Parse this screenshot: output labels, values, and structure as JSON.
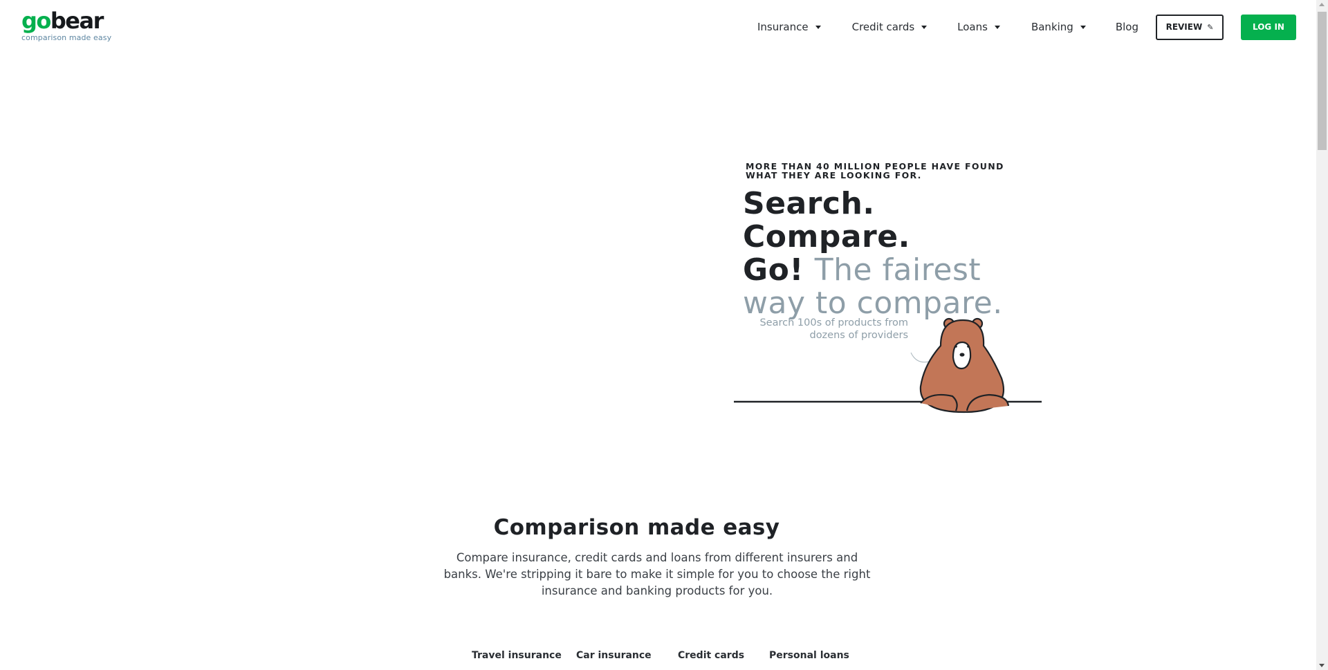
{
  "brand": {
    "logo_go": "go",
    "logo_bear": "bear",
    "tagline": "comparison made easy",
    "primary_color": "#05b04e",
    "bear_color": "#c27657"
  },
  "nav": {
    "items": [
      {
        "label": "Insurance",
        "has_dropdown": true
      },
      {
        "label": "Credit cards",
        "has_dropdown": true
      },
      {
        "label": "Loans",
        "has_dropdown": true
      },
      {
        "label": "Banking",
        "has_dropdown": true
      },
      {
        "label": "Blog",
        "has_dropdown": false
      }
    ],
    "review_label": "REVIEW",
    "review_icon": "pencil-icon",
    "login_label": "LOG IN"
  },
  "hero": {
    "eyebrow_line1": "MORE THAN 40 MILLION PEOPLE HAVE FOUND",
    "eyebrow_line2": "WHAT THEY ARE LOOKING FOR.",
    "title_bold_1": "Search. Compare.",
    "title_bold_2": "Go!",
    "title_light": "The fairest way to compare.",
    "caption_line1": "Search 100s of products from",
    "caption_line2": "dozens of providers"
  },
  "comparison": {
    "title": "Comparison made easy",
    "text": "Compare insurance, credit cards and loans from different insurers and banks. We're stripping it bare to make it simple for you to choose the right insurance and banking products for you.",
    "tabs": [
      "Travel insurance",
      "Car insurance",
      "Credit cards",
      "Personal loans"
    ]
  }
}
